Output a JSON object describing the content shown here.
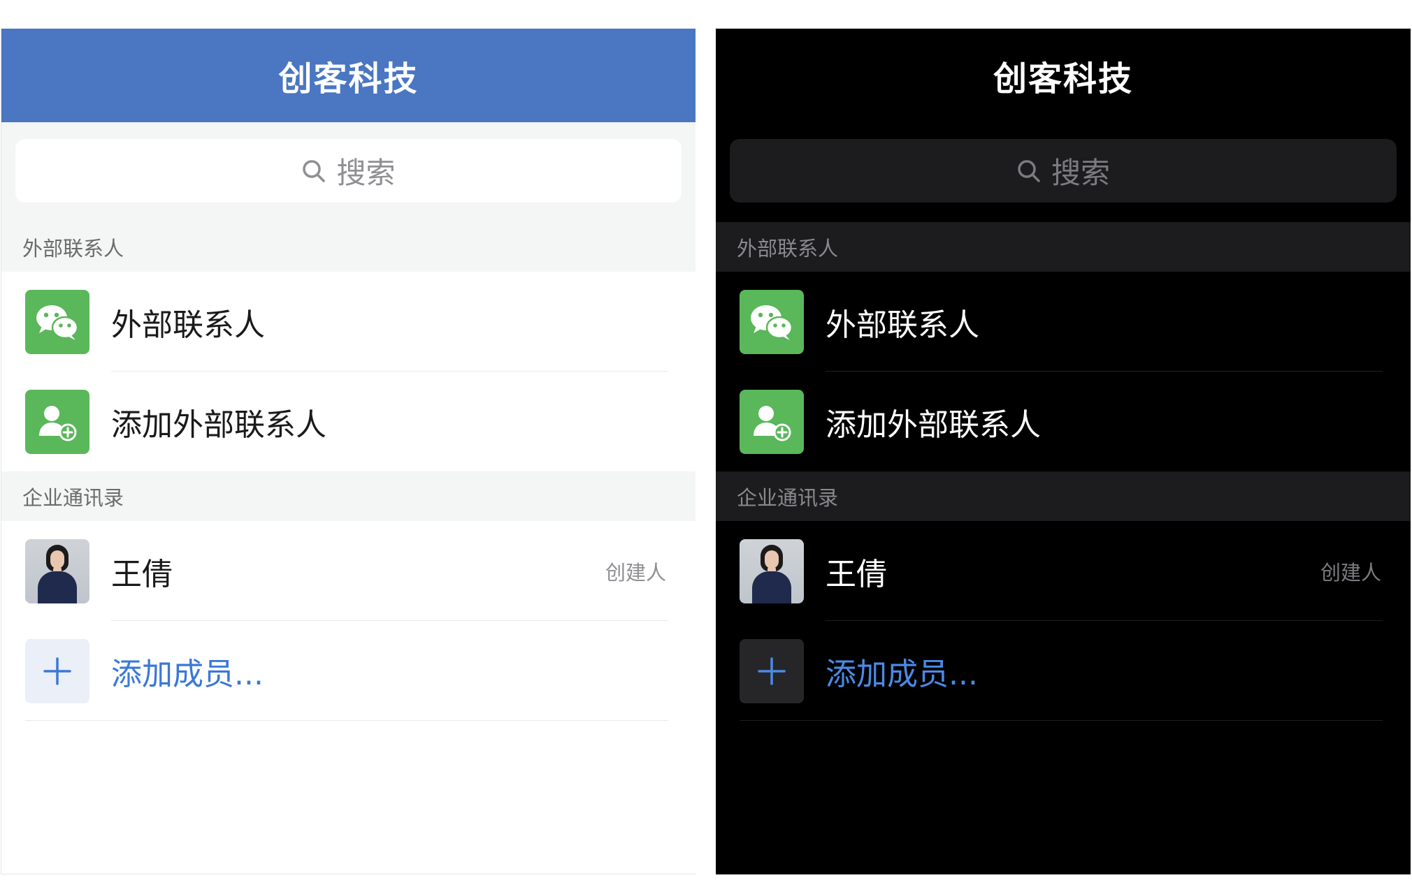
{
  "panels": [
    {
      "theme": "light",
      "header": {
        "title": "创客科技"
      },
      "search": {
        "placeholder": "搜索"
      },
      "sections": {
        "external": {
          "title": "外部联系人",
          "items": [
            {
              "label": "外部联系人",
              "icon": "wechat-icon"
            },
            {
              "label": "添加外部联系人",
              "icon": "add-contact-icon"
            }
          ]
        },
        "directory": {
          "title": "企业通讯录",
          "member": {
            "name": "王倩",
            "role": "创建人"
          },
          "add_member": {
            "label": "添加成员..."
          }
        }
      }
    },
    {
      "theme": "dark",
      "header": {
        "title": "创客科技"
      },
      "search": {
        "placeholder": "搜索"
      },
      "sections": {
        "external": {
          "title": "外部联系人",
          "items": [
            {
              "label": "外部联系人",
              "icon": "wechat-icon"
            },
            {
              "label": "添加外部联系人",
              "icon": "add-contact-icon"
            }
          ]
        },
        "directory": {
          "title": "企业通讯录",
          "member": {
            "name": "王倩",
            "role": "创建人"
          },
          "add_member": {
            "label": "添加成员..."
          }
        }
      }
    }
  ],
  "colors": {
    "light_nav": "#4a76c2",
    "green_icon": "#5ab75a",
    "link_blue": "#3b78d8",
    "dark_bg": "#000000"
  }
}
